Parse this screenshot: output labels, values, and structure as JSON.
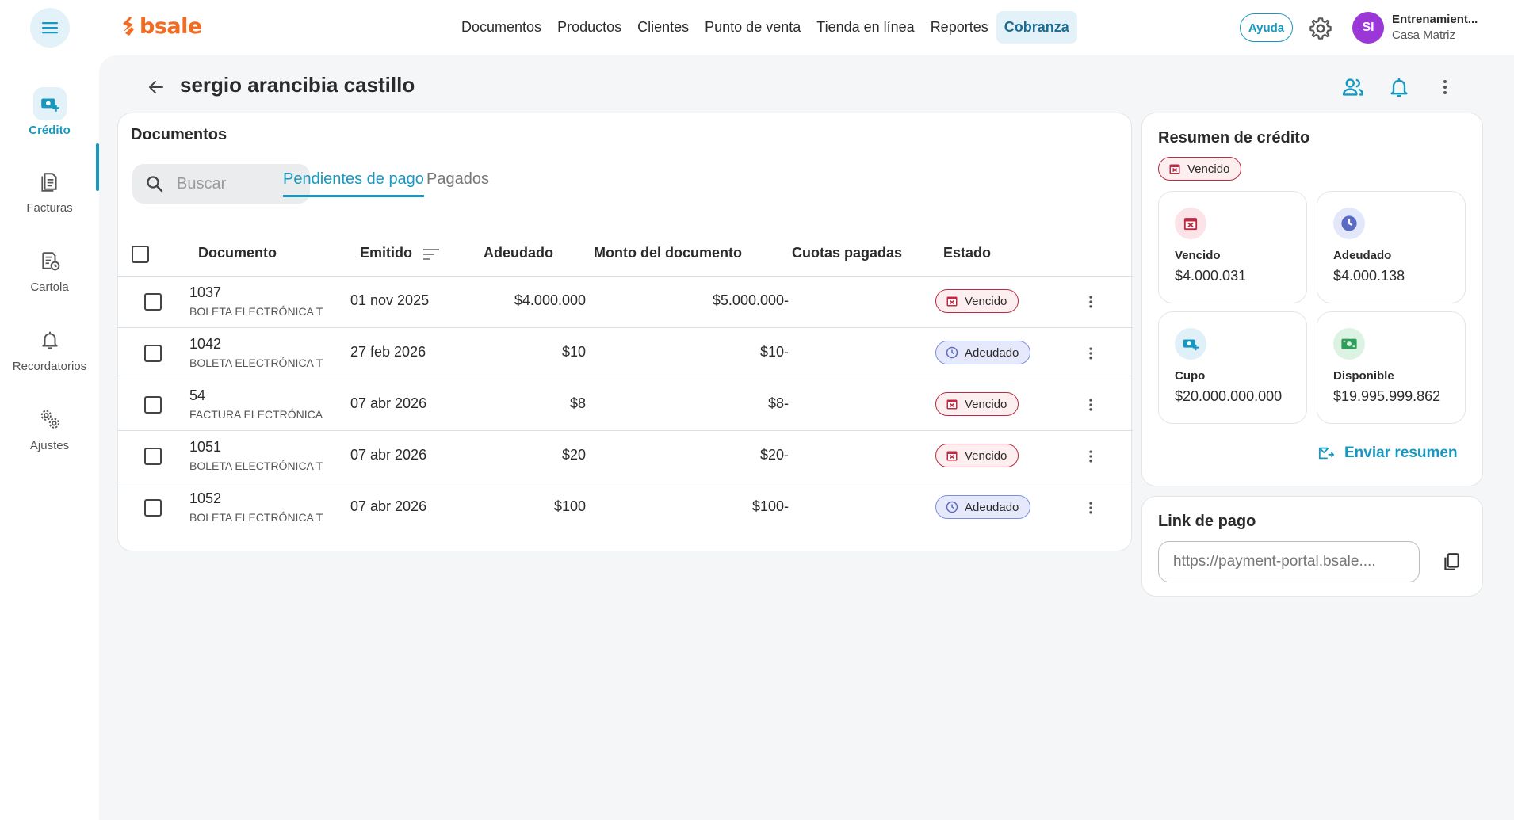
{
  "header": {
    "logo_text": "bsale",
    "nav": [
      {
        "label": "Documentos",
        "active": false
      },
      {
        "label": "Productos",
        "active": false
      },
      {
        "label": "Clientes",
        "active": false
      },
      {
        "label": "Punto de venta",
        "active": false
      },
      {
        "label": "Tienda en línea",
        "active": false
      },
      {
        "label": "Reportes",
        "active": false
      },
      {
        "label": "Cobranza",
        "active": true
      }
    ],
    "help_label": "Ayuda",
    "avatar_initials": "SI",
    "user_name": "Entrenamient...",
    "user_branch": "Casa Matriz"
  },
  "sidebar": {
    "items": [
      {
        "label": "Crédito",
        "icon": "credit-icon",
        "active": true
      },
      {
        "label": "Facturas",
        "icon": "invoices-icon",
        "active": false
      },
      {
        "label": "Cartola",
        "icon": "statement-icon",
        "active": false
      },
      {
        "label": "Recordatorios",
        "icon": "bell-icon",
        "active": false
      },
      {
        "label": "Ajustes",
        "icon": "settings-icon",
        "active": false
      }
    ]
  },
  "page": {
    "title": "sergio arancibia castillo"
  },
  "documents": {
    "title": "Documentos",
    "search_placeholder": "Buscar",
    "tabs": [
      "Pendientes de pago",
      "Pagados"
    ],
    "columns": {
      "documento": "Documento",
      "emitido": "Emitido",
      "adeudado": "Adeudado",
      "monto": "Monto del documento",
      "cuotas": "Cuotas pagadas",
      "estado": "Estado"
    },
    "rows": [
      {
        "number": "1037",
        "type": "BOLETA ELECTRÓNICA T",
        "issued": "01 nov 2025",
        "owed": "$4.000.000",
        "amount": "$5.000.000",
        "installments": "-",
        "status": "Vencido",
        "status_kind": "vencido"
      },
      {
        "number": "1042",
        "type": "BOLETA ELECTRÓNICA T",
        "issued": "27 feb 2026",
        "owed": "$10",
        "amount": "$10",
        "installments": "-",
        "status": "Adeudado",
        "status_kind": "adeudado"
      },
      {
        "number": "54",
        "type": "FACTURA ELECTRÓNICA",
        "issued": "07 abr 2026",
        "owed": "$8",
        "amount": "$8",
        "installments": "-",
        "status": "Vencido",
        "status_kind": "vencido"
      },
      {
        "number": "1051",
        "type": "BOLETA ELECTRÓNICA T",
        "issued": "07 abr 2026",
        "owed": "$20",
        "amount": "$20",
        "installments": "-",
        "status": "Vencido",
        "status_kind": "vencido"
      },
      {
        "number": "1052",
        "type": "BOLETA ELECTRÓNICA T",
        "issued": "07 abr 2026",
        "owed": "$100",
        "amount": "$100",
        "installments": "-",
        "status": "Adeudado",
        "status_kind": "adeudado"
      }
    ]
  },
  "summary": {
    "title": "Resumen de crédito",
    "status": "Vencido",
    "stats": [
      {
        "label": "Vencido",
        "value": "$4.000.031",
        "icon": "calendar-x-icon"
      },
      {
        "label": "Adeudado",
        "value": "$4.000.138",
        "icon": "clock-icon"
      },
      {
        "label": "Cupo",
        "value": "$20.000.000.000",
        "icon": "credit-icon"
      },
      {
        "label": "Disponible",
        "value": "$19.995.999.862",
        "icon": "money-icon"
      }
    ],
    "send_label": "Enviar resumen"
  },
  "payment_link": {
    "title": "Link de pago",
    "value": "https://payment-portal.bsale...."
  },
  "colors": {
    "accent": "#1798c1",
    "brand": "#f26b21",
    "overdue": "#c02942",
    "owed": "#7f8edc",
    "available": "#2e9e5b"
  }
}
